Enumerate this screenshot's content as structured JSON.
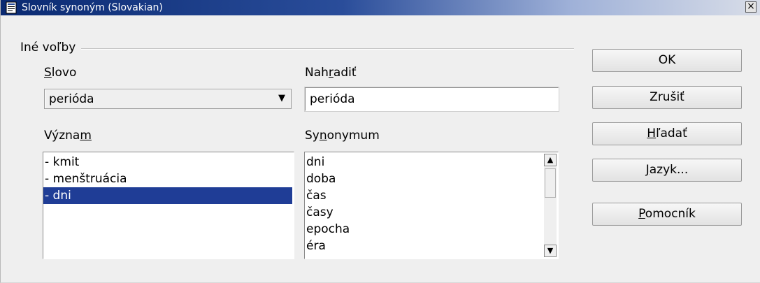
{
  "window": {
    "title": "Slovník synoným (Slovakian)",
    "close_glyph": "×"
  },
  "group": {
    "label": "Iné voľby"
  },
  "word": {
    "label_first": "S",
    "label_rest": "lovo",
    "value": "perióda",
    "dropdown_glyph": "▼"
  },
  "replace": {
    "label_pre": "Nah",
    "label_ul": "r",
    "label_post": "adiť",
    "value": "perióda"
  },
  "meaning": {
    "label_pre": "Význa",
    "label_ul": "m",
    "items": [
      "- kmit",
      "- menštruácia",
      "- dni"
    ],
    "selected_index": 2
  },
  "synonym": {
    "label_pre": "Sy",
    "label_ul": "n",
    "label_post": "onymum",
    "items": [
      "dni",
      "doba",
      "čas",
      "časy",
      "epocha",
      "éra"
    ],
    "scroll_up_glyph": "▲",
    "scroll_down_glyph": "▼"
  },
  "buttons": {
    "ok": "OK",
    "cancel": "Zrušiť",
    "search_ul": "H",
    "search_rest": "ľadať",
    "language_ul": "J",
    "language_rest": "azyk...",
    "help_ul": "P",
    "help_rest": "omocník"
  }
}
